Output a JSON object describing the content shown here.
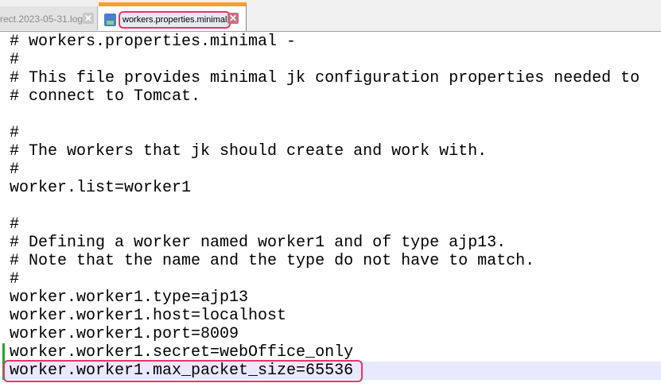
{
  "tabs": [
    {
      "label": "rect.2023-05-31.log",
      "active": false
    },
    {
      "label": "workers.properties.minimal",
      "active": true
    }
  ],
  "editor": {
    "lines": [
      "# workers.properties.minimal -",
      "#",
      "# This file provides minimal jk configuration properties needed to",
      "# connect to Tomcat.",
      "",
      "#",
      "# The workers that jk should create and work with.",
      "#",
      "worker.list=worker1",
      "",
      "#",
      "# Defining a worker named worker1 and of type ajp13.",
      "# Note that the name and the type do not have to match.",
      "#",
      "worker.worker1.type=ajp13",
      "worker.worker1.host=localhost",
      "worker.worker1.port=8009",
      "worker.worker1.secret=webOffice_only",
      "worker.worker1.max_packet_size=65536"
    ]
  }
}
